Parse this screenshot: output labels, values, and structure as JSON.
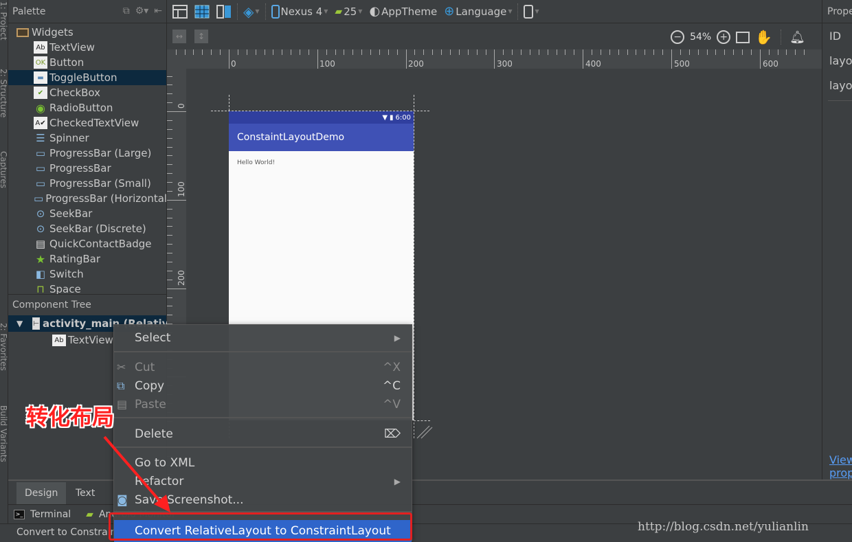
{
  "left_strip": {
    "labels": [
      "1: Project",
      "2: Structure",
      "Captures",
      "2: Favorites",
      "Build Variants"
    ]
  },
  "palette": {
    "title": "Palette",
    "group": "Widgets",
    "items": [
      {
        "label": "TextView",
        "icon": "textview-icon",
        "glyph": "Ab",
        "selected": false
      },
      {
        "label": "Button",
        "icon": "button-icon",
        "glyph": "OK",
        "selected": false
      },
      {
        "label": "ToggleButton",
        "icon": "togglebutton-icon",
        "glyph": "▬",
        "selected": true
      },
      {
        "label": "CheckBox",
        "icon": "checkbox-icon",
        "glyph": "✔",
        "selected": false
      },
      {
        "label": "RadioButton",
        "icon": "radiobutton-icon",
        "glyph": "◉",
        "selected": false
      },
      {
        "label": "CheckedTextView",
        "icon": "checkedtextview-icon",
        "glyph": "A✔",
        "selected": false
      },
      {
        "label": "Spinner",
        "icon": "spinner-icon",
        "glyph": "☰",
        "selected": false
      },
      {
        "label": "ProgressBar (Large)",
        "icon": "progressbar-icon",
        "glyph": "▭",
        "selected": false
      },
      {
        "label": "ProgressBar",
        "icon": "progressbar-icon",
        "glyph": "▭",
        "selected": false
      },
      {
        "label": "ProgressBar (Small)",
        "icon": "progressbar-icon",
        "glyph": "▭",
        "selected": false
      },
      {
        "label": "ProgressBar (Horizontal)",
        "icon": "progressbar-icon",
        "glyph": "▭",
        "selected": false
      },
      {
        "label": "SeekBar",
        "icon": "seekbar-icon",
        "glyph": "⊙",
        "selected": false
      },
      {
        "label": "SeekBar (Discrete)",
        "icon": "seekbar-icon",
        "glyph": "⊙",
        "selected": false
      },
      {
        "label": "QuickContactBadge",
        "icon": "contact-badge-icon",
        "glyph": "▤",
        "selected": false
      },
      {
        "label": "RatingBar",
        "icon": "star-icon",
        "glyph": "★",
        "selected": false
      },
      {
        "label": "Switch",
        "icon": "switch-icon",
        "glyph": "◧",
        "selected": false
      },
      {
        "label": "Space",
        "icon": "space-icon",
        "glyph": "⊓",
        "selected": false
      }
    ]
  },
  "component_tree": {
    "title": "Component Tree",
    "root": "activity_main (RelativeLayout)",
    "child": "TextView"
  },
  "toolbar": {
    "device": "Nexus 4",
    "api": "25",
    "theme": "AppTheme",
    "language": "Language"
  },
  "zoom": {
    "level": "54%"
  },
  "rulers": {
    "horizontal": [
      "0",
      "100",
      "200",
      "300",
      "400",
      "500",
      "600"
    ],
    "vertical": [
      "0",
      "100",
      "200"
    ]
  },
  "device_preview": {
    "time": "6:00",
    "app_title": "ConstaintLayoutDemo",
    "body_text": "Hello World!"
  },
  "properties": {
    "title": "Properties",
    "rows": [
      "ID",
      "layout_width",
      "layout_height"
    ],
    "link": "View all properties"
  },
  "bottom_tabs": {
    "design": "Design",
    "text": "Text"
  },
  "tool_windows": {
    "terminal": "Terminal",
    "android_monitor": "Android Monitor"
  },
  "status": {
    "text": "Convert to ConstraintLayout"
  },
  "context_menu": {
    "items": [
      {
        "label": "Select",
        "shortcut": "",
        "submenu": true,
        "disabled": false,
        "icon": ""
      },
      {
        "label": "Cut",
        "shortcut": "^X",
        "submenu": false,
        "disabled": true,
        "icon": "scissors-icon"
      },
      {
        "label": "Copy",
        "shortcut": "^C",
        "submenu": false,
        "disabled": false,
        "icon": "copy-icon"
      },
      {
        "label": "Paste",
        "shortcut": "^V",
        "submenu": false,
        "disabled": true,
        "icon": "paste-icon"
      },
      {
        "label": "Delete",
        "shortcut": "⌦",
        "submenu": false,
        "disabled": false,
        "icon": ""
      },
      {
        "label": "Go to XML",
        "shortcut": "",
        "submenu": false,
        "disabled": false,
        "icon": ""
      },
      {
        "label": "Refactor",
        "shortcut": "",
        "submenu": true,
        "disabled": false,
        "icon": ""
      },
      {
        "label": "Save Screenshot...",
        "shortcut": "",
        "submenu": false,
        "disabled": false,
        "icon": "camera-icon"
      },
      {
        "label": "Convert RelativeLayout to ConstraintLayout",
        "shortcut": "",
        "submenu": false,
        "disabled": false,
        "icon": "",
        "highlighted": true
      }
    ]
  },
  "annotation": {
    "text": "转化布局",
    "color": "#ff2020"
  },
  "watermark": "http://blog.csdn.net/yulianlin",
  "colors": {
    "accent": "#2f65ca",
    "app_bar": "#3f51b5",
    "status_bar": "#303f9f",
    "selection": "#0d293e",
    "annotation_red": "#e32020"
  }
}
